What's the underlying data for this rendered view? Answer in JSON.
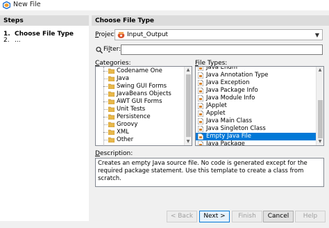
{
  "window": {
    "title": "New File"
  },
  "steps": {
    "header": "Steps",
    "items": [
      {
        "num": "1.",
        "label": "Choose File Type"
      },
      {
        "num": "2.",
        "label": "..."
      }
    ]
  },
  "main": {
    "header": "Choose File Type",
    "project_label_prefix": "P",
    "project_label_rest": "roject:",
    "project_value": "Input_Output",
    "filter_label_prefix": "Fi",
    "filter_label_u": "l",
    "filter_label_rest": "ter:",
    "filter_value": "",
    "categories_label_prefix": "",
    "categories_label_u": "C",
    "categories_label_rest": "ategories:",
    "filetypes_label_u": "F",
    "filetypes_label_rest": "ile Types:",
    "categories": [
      "Codename One",
      "Java",
      "Swing GUI Forms",
      "JavaBeans Objects",
      "AWT GUI Forms",
      "Unit Tests",
      "Persistence",
      "Groovy",
      "XML",
      "Other"
    ],
    "file_types": [
      "Java Enum",
      "Java Annotation Type",
      "Java Exception",
      "Java Package Info",
      "Java Module Info",
      "JApplet",
      "Applet",
      "Java Main Class",
      "Java Singleton Class",
      "Empty Java File",
      "Java Package"
    ],
    "selected_file_type": "Empty Java File",
    "description_label_u": "D",
    "description_label_rest": "escription:",
    "description_text": "Creates an empty Java source file. No code is generated except for the required package statement. Use this template to create a class from scratch."
  },
  "buttons": {
    "back": "< Back",
    "next": "Next >",
    "finish": "Finish",
    "cancel": "Cancel",
    "help": "Help"
  },
  "colors": {
    "selection": "#0078d7",
    "folder": "#e8b84a",
    "header_bg": "#dcdcdc"
  }
}
